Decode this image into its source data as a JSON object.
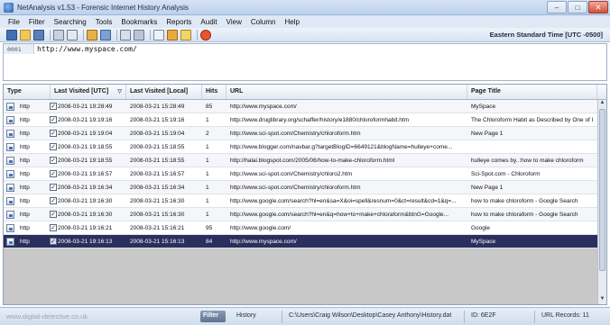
{
  "window": {
    "title": "NetAnalysis v1.53 - Forensic Internet History Analysis",
    "buttons": [
      "–",
      "□",
      "✕"
    ]
  },
  "menu": [
    "File",
    "Filter",
    "Searching",
    "Tools",
    "Bookmarks",
    "Reports",
    "Audit",
    "View",
    "Column",
    "Help"
  ],
  "toolbar": {
    "icons": [
      "table-icon",
      "open-icon",
      "save-icon",
      "print-icon",
      "print-preview-icon",
      "bookmark-icon",
      "filter-icon",
      "search-icon",
      "tools-icon",
      "export-icon",
      "report-icon",
      "star-icon",
      "stop-icon"
    ],
    "timezone": "Eastern Standard Time [UTC -0500]"
  },
  "url_panel": {
    "line_number": "0001",
    "url": "http://www.myspace.com/"
  },
  "columns": [
    "Type",
    "Last Visited [UTC]",
    "Last Visited [Local]",
    "Hits",
    "URL",
    "Page Title"
  ],
  "rows": [
    {
      "type": "http",
      "utc": "2008-03-21 19:28:49",
      "local": "2008-03-21 15:28:49",
      "hits": "85",
      "url": "http://www.myspace.com/",
      "title": "MySpace"
    },
    {
      "type": "http",
      "utc": "2008-03-21 19:19:16",
      "local": "2008-03-21 15:19:16",
      "hits": "1",
      "url": "http://www.druglibrary.org/schaffer/history/e1880/chloroformhabit.htm",
      "title": "The Chloroform Habit as Described by One of I"
    },
    {
      "type": "http",
      "utc": "2008-03-21 19:19:04",
      "local": "2008-03-21 15:19:04",
      "hits": "2",
      "url": "http://www.sci-spot.com/Chemistry/chloroform.htm",
      "title": "New Page 1"
    },
    {
      "type": "http",
      "utc": "2008-03-21 19:18:55",
      "local": "2008-03-21 15:18:55",
      "hits": "1",
      "url": "http://www.blogger.com/navbar.g?targetBlogID=6649121&blogName=hulleye+come...",
      "title": ""
    },
    {
      "type": "http",
      "utc": "2008-03-21 19:18:55",
      "local": "2008-03-21 15:18:55",
      "hits": "1",
      "url": "http://halai.blogspot.com/2005/06/how-to-make-chloroform.html",
      "title": "hulleye comes by..:how to make chloroform"
    },
    {
      "type": "http",
      "utc": "2008-03-21 19:16:57",
      "local": "2008-03-21 15:16:57",
      "hits": "1",
      "url": "http://www.sci-spot.com/Chemistry/chloro2.htm",
      "title": "Sci-Spot.com - Chloroform"
    },
    {
      "type": "http",
      "utc": "2008-03-21 19:16:34",
      "local": "2008-03-21 15:16:34",
      "hits": "1",
      "url": "http://www.sci-spot.com/Chemistry/chloroform.htm",
      "title": "New Page 1"
    },
    {
      "type": "http",
      "utc": "2008-03-21 19:16:30",
      "local": "2008-03-21 15:16:30",
      "hits": "1",
      "url": "http://www.google.com/search?hl=en&sa=X&oi=spell&resnum=0&ct=result&cd=1&q=...",
      "title": "how to make chloroform - Google Search"
    },
    {
      "type": "http",
      "utc": "2008-03-21 19:16:30",
      "local": "2008-03-21 15:16:30",
      "hits": "1",
      "url": "http://www.google.com/search?hl=en&q=how+to+make+chloraform&btnG=Google...",
      "title": "how to make chloraform - Google Search"
    },
    {
      "type": "http",
      "utc": "2008-03-21 19:16:21",
      "local": "2008-03-21 15:16:21",
      "hits": "95",
      "url": "http://www.google.com/",
      "title": "Google"
    },
    {
      "type": "http",
      "utc": "2008-03-21 19:16:13",
      "local": "2008-03-21 15:16:13",
      "hits": "84",
      "url": "http://www.myspace.com/",
      "title": "MySpace"
    }
  ],
  "status": {
    "website": "www.digital-detective.co.uk",
    "filter": "Filter",
    "history": "History",
    "path": "C:\\Users\\Craig Wilson\\Desktop\\Casey Anthony\\History.dat",
    "id": "ID: 6E2F",
    "records": "URL Records:  11"
  }
}
